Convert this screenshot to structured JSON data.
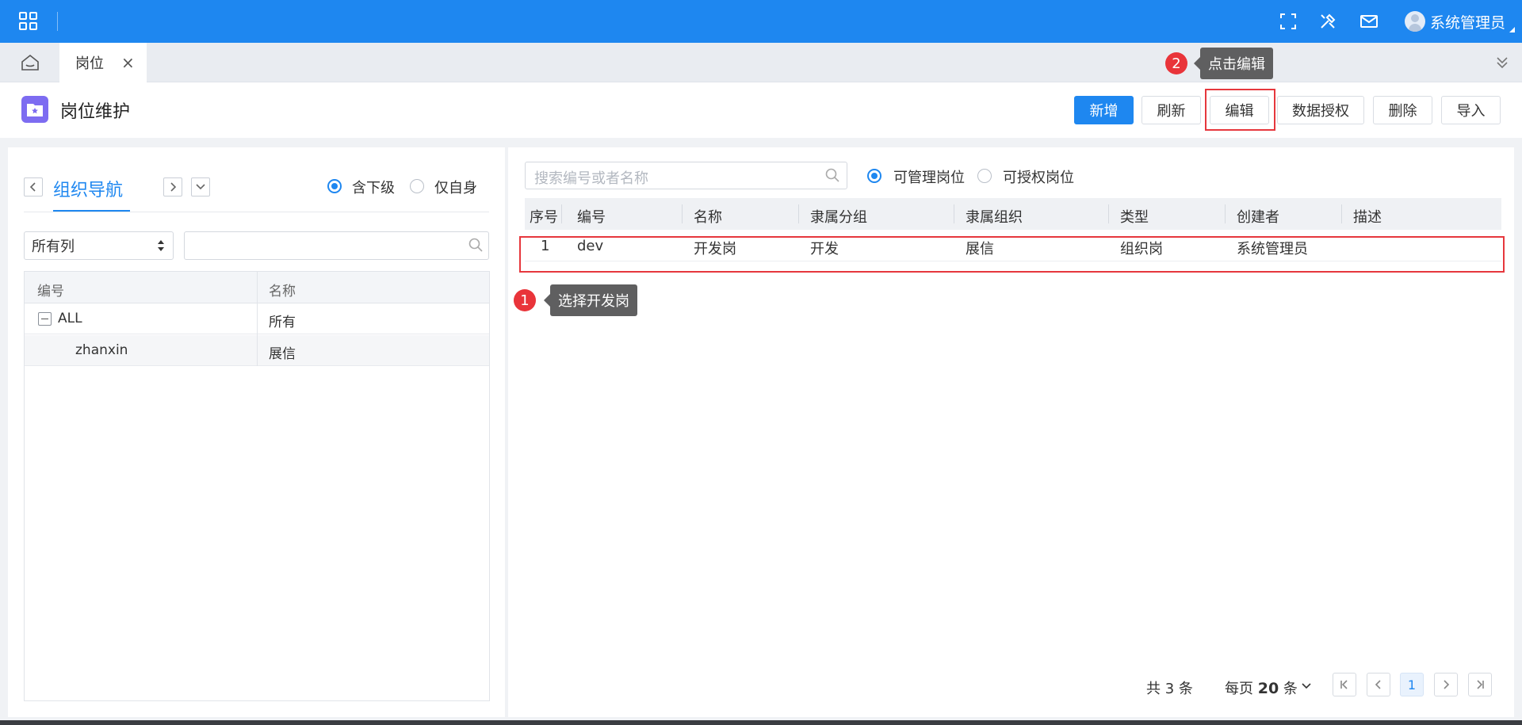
{
  "topbar": {
    "user_name": "系统管理员",
    "icons": [
      "apps-grid-icon",
      "fullscreen-icon",
      "tools-icon",
      "mail-icon",
      "avatar-icon"
    ],
    "accent_color": "#1e87f0"
  },
  "tabs": {
    "active_tab": "岗位",
    "close_glyph": "×"
  },
  "page": {
    "title": "岗位维护",
    "buttons": {
      "add": "新增",
      "refresh": "刷新",
      "edit": "编辑",
      "data_auth": "数据授权",
      "delete": "删除",
      "import": "导入"
    }
  },
  "left": {
    "nav_title": "组织导航",
    "radio_include_sub": "含下级",
    "radio_self_only": "仅自身",
    "radio_selected": "含下级",
    "column_select_value": "所有列",
    "search_value": "",
    "tree_headers": {
      "code": "编号",
      "name": "名称"
    },
    "tree_rows": [
      {
        "code": "ALL",
        "name": "所有"
      },
      {
        "code": "zhanxin",
        "name": "展信"
      }
    ]
  },
  "right": {
    "search_placeholder": "搜索编号或者名称",
    "radio_manageable": "可管理岗位",
    "radio_authorizable": "可授权岗位",
    "radio_selected": "可管理岗位",
    "headers": [
      "序号",
      "编号",
      "名称",
      "隶属分组",
      "隶属组织",
      "类型",
      "创建者",
      "描述"
    ],
    "rows": [
      [
        "1",
        "dev",
        "开发岗",
        "开发",
        "展信",
        "组织岗",
        "系统管理员",
        ""
      ]
    ],
    "pager": {
      "total_text": "共 3 条",
      "per_page_prefix": "每页 ",
      "per_page_value": "20",
      "per_page_suffix": " 条",
      "current_page": "1"
    }
  },
  "annotations": {
    "step1_number": "1",
    "step1_text": "选择开发岗",
    "step2_number": "2",
    "step2_text": "点击编辑",
    "highlight_color": "#e6373d"
  }
}
